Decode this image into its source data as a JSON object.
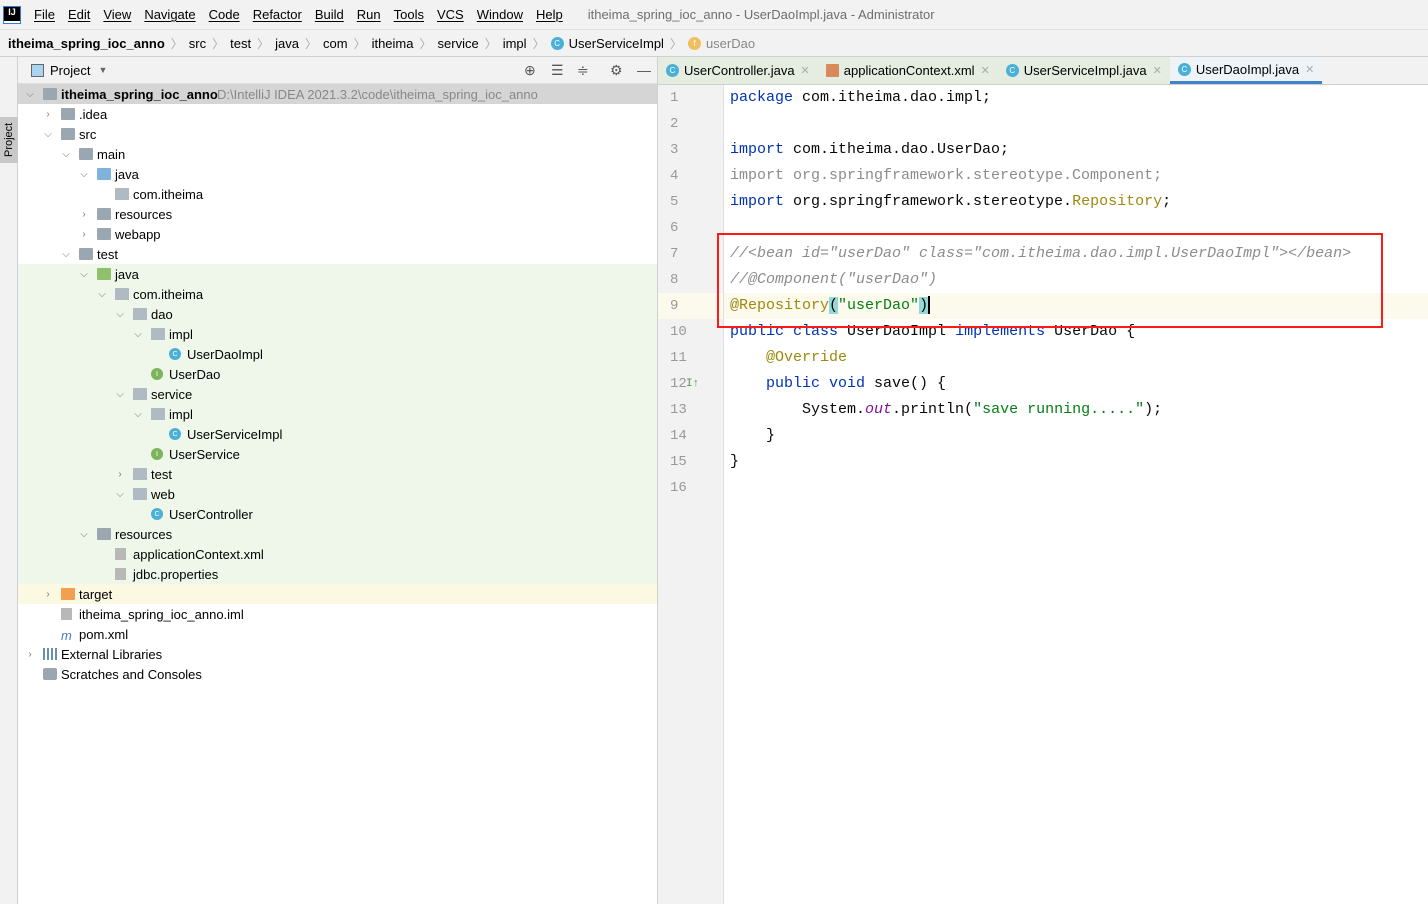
{
  "menubar": {
    "items": [
      "File",
      "Edit",
      "View",
      "Navigate",
      "Code",
      "Refactor",
      "Build",
      "Run",
      "Tools",
      "VCS",
      "Window",
      "Help"
    ],
    "window_title": "itheima_spring_ioc_anno - UserDaoImpl.java - Administrator"
  },
  "breadcrumb": [
    {
      "label": "itheima_spring_ioc_anno",
      "bold": true
    },
    {
      "label": "src"
    },
    {
      "label": "test"
    },
    {
      "label": "java"
    },
    {
      "label": "com"
    },
    {
      "label": "itheima"
    },
    {
      "label": "service"
    },
    {
      "label": "impl"
    },
    {
      "label": "UserServiceImpl",
      "icon": "class"
    },
    {
      "label": "userDao",
      "icon": "field",
      "dim": true
    }
  ],
  "stripe": {
    "project_label": "Project"
  },
  "project_panel": {
    "title": "Project",
    "root_path": "D:\\IntelliJ IDEA 2021.3.2\\code\\itheima_spring_ioc_anno",
    "tree": [
      {
        "label": "itheima_spring_ioc_anno",
        "depth": 0,
        "arrow": "open",
        "icon": "module",
        "bold": true,
        "bg": "sel"
      },
      {
        "label": ".idea",
        "depth": 1,
        "arrow": "closed",
        "icon": "folder"
      },
      {
        "label": "src",
        "depth": 1,
        "arrow": "open",
        "icon": "folder"
      },
      {
        "label": "main",
        "depth": 2,
        "arrow": "open",
        "icon": "folder"
      },
      {
        "label": "java",
        "depth": 3,
        "arrow": "open",
        "icon": "folder-blue"
      },
      {
        "label": "com.itheima",
        "depth": 4,
        "icon": "package"
      },
      {
        "label": "resources",
        "depth": 3,
        "arrow": "closed",
        "icon": "folder"
      },
      {
        "label": "webapp",
        "depth": 3,
        "arrow": "closed",
        "icon": "folder"
      },
      {
        "label": "test",
        "depth": 2,
        "arrow": "open",
        "icon": "folder"
      },
      {
        "label": "java",
        "depth": 3,
        "arrow": "open",
        "icon": "folder-green",
        "bg": "test"
      },
      {
        "label": "com.itheima",
        "depth": 4,
        "arrow": "open",
        "icon": "package",
        "bg": "test"
      },
      {
        "label": "dao",
        "depth": 5,
        "arrow": "open",
        "icon": "package",
        "bg": "test"
      },
      {
        "label": "impl",
        "depth": 6,
        "arrow": "open",
        "icon": "package",
        "bg": "test"
      },
      {
        "label": "UserDaoImpl",
        "depth": 7,
        "icon": "class",
        "bg": "test"
      },
      {
        "label": "UserDao",
        "depth": 6,
        "icon": "interface",
        "bg": "test"
      },
      {
        "label": "service",
        "depth": 5,
        "arrow": "open",
        "icon": "package",
        "bg": "test"
      },
      {
        "label": "impl",
        "depth": 6,
        "arrow": "open",
        "icon": "package",
        "bg": "test"
      },
      {
        "label": "UserServiceImpl",
        "depth": 7,
        "icon": "class",
        "bg": "test"
      },
      {
        "label": "UserService",
        "depth": 6,
        "icon": "interface",
        "bg": "test"
      },
      {
        "label": "test",
        "depth": 5,
        "arrow": "closed",
        "icon": "package",
        "bg": "test"
      },
      {
        "label": "web",
        "depth": 5,
        "arrow": "open",
        "icon": "package",
        "bg": "test"
      },
      {
        "label": "UserController",
        "depth": 6,
        "icon": "class",
        "bg": "test"
      },
      {
        "label": "resources",
        "depth": 3,
        "arrow": "open",
        "icon": "folder",
        "bg": "test"
      },
      {
        "label": "applicationContext.xml",
        "depth": 4,
        "icon": "file",
        "bg": "test"
      },
      {
        "label": "jdbc.properties",
        "depth": 4,
        "icon": "file",
        "bg": "test"
      },
      {
        "label": "target",
        "depth": 1,
        "arrow": "closed",
        "icon": "folder-orange",
        "bg": "excluded"
      },
      {
        "label": "itheima_spring_ioc_anno.iml",
        "depth": 1,
        "icon": "file"
      },
      {
        "label": "pom.xml",
        "depth": 1,
        "icon": "pom"
      },
      {
        "label": "External Libraries",
        "depth": 0,
        "arrow": "closed",
        "icon": "library"
      },
      {
        "label": "Scratches and Consoles",
        "depth": 0,
        "icon": "scratch"
      }
    ]
  },
  "editor": {
    "tabs": [
      {
        "label": "UserController.java",
        "icon": "class"
      },
      {
        "label": "applicationContext.xml",
        "icon": "xml"
      },
      {
        "label": "UserServiceImpl.java",
        "icon": "class"
      },
      {
        "label": "UserDaoImpl.java",
        "icon": "class",
        "active": true
      }
    ],
    "current_line": 9,
    "lines": [
      [
        [
          "package ",
          "kw"
        ],
        [
          "com.itheima.dao.impl;",
          "id"
        ]
      ],
      [],
      [
        [
          "import ",
          "kw"
        ],
        [
          "com.itheima.dao.UserDao;",
          "id"
        ]
      ],
      [
        [
          "import org.springframework.stereotype.Component;",
          "dim"
        ]
      ],
      [
        [
          "import ",
          "kw"
        ],
        [
          "org.springframework.stereotype.",
          "id"
        ],
        [
          "Repository",
          "ann"
        ],
        [
          ";",
          "id"
        ]
      ],
      [],
      [
        [
          "//<bean id=\"userDao\" class=\"com.itheima.dao.impl.UserDaoImpl\"></bean>",
          "cm"
        ]
      ],
      [
        [
          "//@Component(\"userDao\")",
          "cm"
        ]
      ],
      [
        [
          "@Repository",
          "ann"
        ],
        [
          "(",
          "br"
        ],
        [
          "\"userDao\"",
          "str"
        ],
        [
          ")",
          "br"
        ]
      ],
      [
        [
          "public ",
          "kw"
        ],
        [
          "class ",
          "kw"
        ],
        [
          "UserDaoImpl ",
          "id"
        ],
        [
          "implements ",
          "kw"
        ],
        [
          "UserDao {",
          "id"
        ]
      ],
      [
        [
          "    ",
          "id"
        ],
        [
          "@Override",
          "ann"
        ]
      ],
      [
        [
          "    ",
          "id"
        ],
        [
          "public ",
          "kw"
        ],
        [
          "void ",
          "kw"
        ],
        [
          "save() {",
          "id"
        ]
      ],
      [
        [
          "        System.",
          "id"
        ],
        [
          "out",
          "st"
        ],
        [
          ".println(",
          "id"
        ],
        [
          "\"save running.....\"",
          "str"
        ],
        [
          ");",
          "id"
        ]
      ],
      [
        [
          "    }",
          "id"
        ]
      ],
      [
        [
          "}",
          "id"
        ]
      ],
      []
    ]
  }
}
